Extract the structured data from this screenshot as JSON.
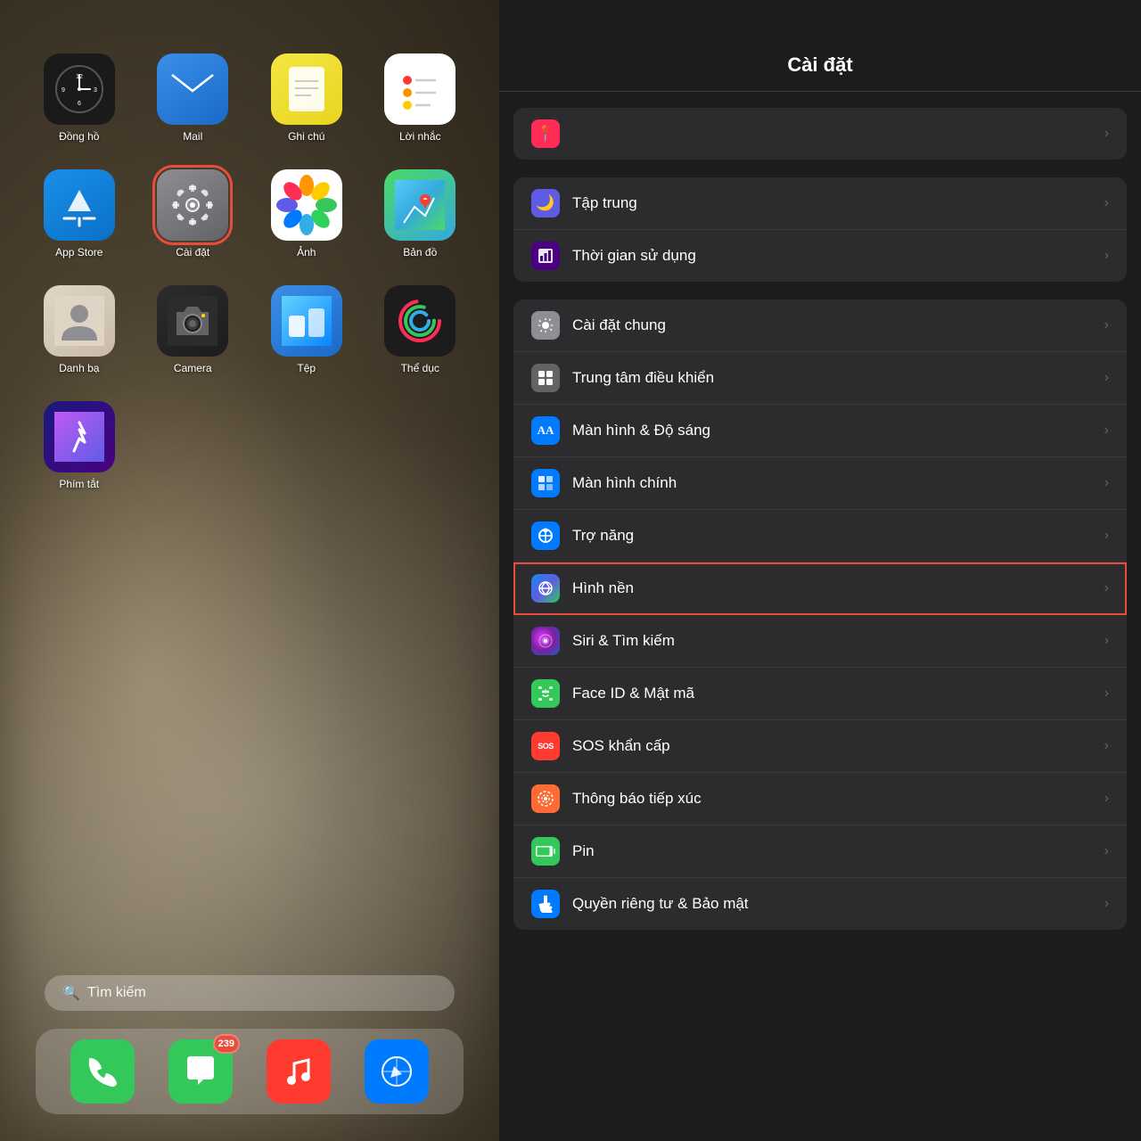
{
  "left": {
    "apps": [
      {
        "id": "clock",
        "label": "Đồng hồ",
        "icon_type": "clock",
        "outlined": false
      },
      {
        "id": "mail",
        "label": "Mail",
        "icon_type": "mail",
        "outlined": false
      },
      {
        "id": "notes",
        "label": "Ghi chú",
        "icon_type": "notes",
        "outlined": false
      },
      {
        "id": "reminders",
        "label": "Lời nhắc",
        "icon_type": "reminders",
        "outlined": false
      },
      {
        "id": "appstore",
        "label": "App Store",
        "icon_type": "appstore",
        "outlined": false
      },
      {
        "id": "settings",
        "label": "Cài đặt",
        "icon_type": "settings",
        "outlined": true
      },
      {
        "id": "photos",
        "label": "Ảnh",
        "icon_type": "photos",
        "outlined": false
      },
      {
        "id": "maps",
        "label": "Bản đồ",
        "icon_type": "maps",
        "outlined": false
      },
      {
        "id": "contacts",
        "label": "Danh bạ",
        "icon_type": "contacts",
        "outlined": false
      },
      {
        "id": "camera",
        "label": "Camera",
        "icon_type": "camera",
        "outlined": false
      },
      {
        "id": "files",
        "label": "Tệp",
        "icon_type": "files",
        "outlined": false
      },
      {
        "id": "fitness",
        "label": "Thể dục",
        "icon_type": "fitness",
        "outlined": false
      },
      {
        "id": "shortcuts",
        "label": "Phím tắt",
        "icon_type": "shortcuts",
        "outlined": false
      }
    ],
    "search": {
      "icon": "🔍",
      "placeholder": "Tìm kiếm"
    },
    "dock": [
      {
        "id": "phone",
        "icon": "📞",
        "bg": "#34c759",
        "badge": null
      },
      {
        "id": "messages",
        "icon": "💬",
        "bg": "#34c759",
        "badge": "239"
      },
      {
        "id": "music",
        "icon": "🎵",
        "bg": "#ff3b30",
        "badge": null
      },
      {
        "id": "safari",
        "icon": "🧭",
        "bg": "#007aff",
        "badge": null
      }
    ]
  },
  "right": {
    "header": {
      "title": "Cài đặt"
    },
    "top_item_visible": true,
    "rows": [
      {
        "section": 0,
        "items": [
          {
            "id": "tap-trung",
            "label": "Tập trung",
            "icon_color": "ic-purple",
            "icon_symbol": "🌙",
            "highlighted": false
          },
          {
            "id": "thoi-gian",
            "label": "Thời gian sử dụng",
            "icon_color": "ic-indigo",
            "icon_symbol": "⏳",
            "highlighted": false
          }
        ]
      },
      {
        "section": 1,
        "items": [
          {
            "id": "cai-dat-chung",
            "label": "Cài đặt chung",
            "icon_color": "ic-gray",
            "icon_symbol": "⚙️",
            "highlighted": false
          },
          {
            "id": "trung-tam",
            "label": "Trung tâm điều khiển",
            "icon_color": "ic-dark-gray",
            "icon_symbol": "⊞",
            "highlighted": false
          },
          {
            "id": "man-hinh",
            "label": "Màn hình & Độ sáng",
            "icon_color": "ic-blue",
            "icon_symbol": "AA",
            "highlighted": false
          },
          {
            "id": "man-hinh-chinh",
            "label": "Màn hình chính",
            "icon_color": "ic-blue",
            "icon_symbol": "⊞",
            "highlighted": false
          },
          {
            "id": "tro-nang",
            "label": "Trợ năng",
            "icon_color": "ic-blue",
            "icon_symbol": "♿",
            "highlighted": false
          },
          {
            "id": "hinh-nen",
            "label": "Hình nền",
            "icon_color": "ic-wallpaper",
            "icon_symbol": "✿",
            "highlighted": true
          },
          {
            "id": "siri",
            "label": "Siri & Tìm kiếm",
            "icon_color": "ic-siri",
            "icon_symbol": "◉",
            "highlighted": false
          },
          {
            "id": "faceid",
            "label": "Face ID & Mật mã",
            "icon_color": "ic-faceid",
            "icon_symbol": "😊",
            "highlighted": false
          },
          {
            "id": "sos",
            "label": "SOS khẩn cấp",
            "icon_color": "ic-sos",
            "icon_symbol": "SOS",
            "highlighted": false
          },
          {
            "id": "contact-tracing",
            "label": "Thông báo tiếp xúc",
            "icon_color": "ic-contact",
            "icon_symbol": "❋",
            "highlighted": false
          },
          {
            "id": "pin",
            "label": "Pin",
            "icon_color": "ic-battery",
            "icon_symbol": "▬",
            "highlighted": false
          },
          {
            "id": "privacy",
            "label": "Quyền riêng tư & Bảo mật",
            "icon_color": "ic-privacy",
            "icon_symbol": "✋",
            "highlighted": false
          }
        ]
      }
    ]
  }
}
